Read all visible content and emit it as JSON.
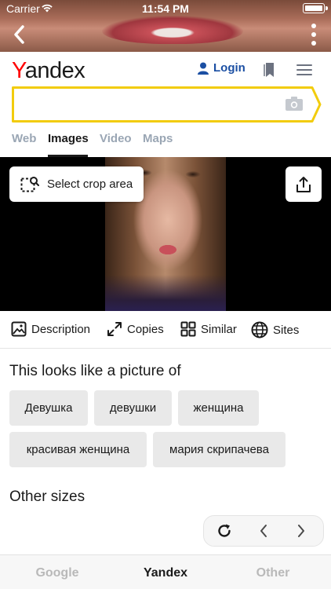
{
  "status_bar": {
    "carrier": "Carrier",
    "time": "11:54 PM"
  },
  "header": {
    "logo_first": "Y",
    "logo_rest": "andex",
    "login_label": "Login",
    "search": {
      "value": "",
      "placeholder": ""
    }
  },
  "tabs": [
    {
      "label": "Web",
      "active": false
    },
    {
      "label": "Images",
      "active": true
    },
    {
      "label": "Video",
      "active": false
    },
    {
      "label": "Maps",
      "active": false
    }
  ],
  "photo_toolbar": {
    "crop_label": "Select crop area"
  },
  "actions": [
    {
      "label": "Description",
      "icon": "image-icon"
    },
    {
      "label": "Copies",
      "icon": "expand-icon"
    },
    {
      "label": "Similar",
      "icon": "grid-icon"
    },
    {
      "label": "Sites",
      "icon": "globe-icon"
    }
  ],
  "looks_like": {
    "title": "This looks like a picture of",
    "tags": [
      "Девушка",
      "девушки",
      "женщина",
      "красивая женщина",
      "мария скрипачева"
    ]
  },
  "other_sizes": {
    "title": "Other sizes"
  },
  "bottom_tabs": [
    {
      "label": "Google",
      "active": false
    },
    {
      "label": "Yandex",
      "active": true
    },
    {
      "label": "Other",
      "active": false
    }
  ],
  "colors": {
    "logo_red": "#ff0000",
    "login_blue": "#1b4fa3",
    "search_border": "#f2cc0d",
    "inactive_tab": "#9aa6b4",
    "chip_bg": "#e9e9e9"
  }
}
